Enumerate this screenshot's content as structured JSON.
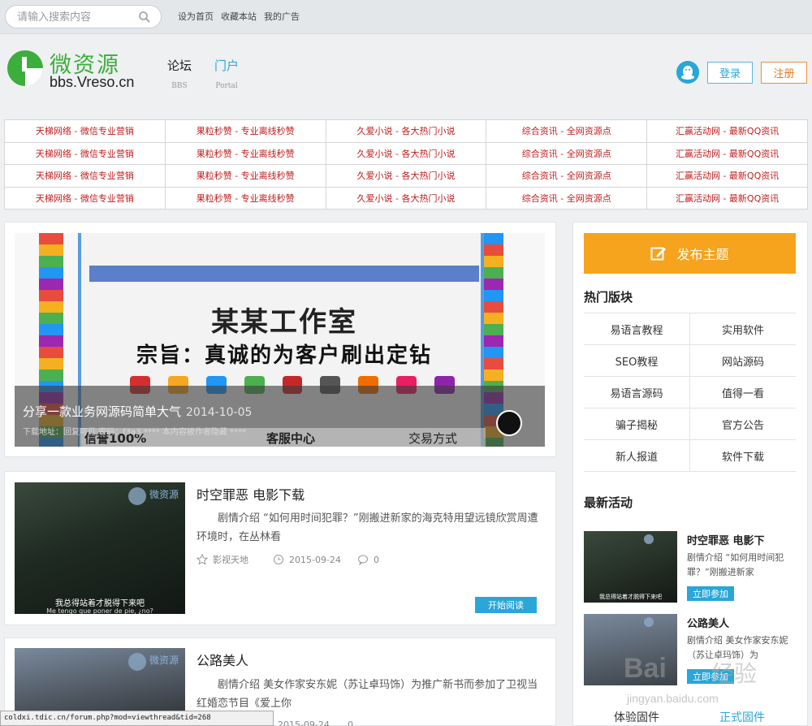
{
  "topbar": {
    "search_placeholder": "请输入搜索内容",
    "links": [
      "设为首页",
      "收藏本站",
      "我的广告"
    ]
  },
  "logo": {
    "cn": "微资源",
    "en": "bbs.Vreso.cn"
  },
  "nav": [
    {
      "label": "论坛",
      "sub": "BBS",
      "active": false
    },
    {
      "label": "门户",
      "sub": "Portal",
      "active": true
    }
  ],
  "auth": {
    "login": "登录",
    "register": "注册"
  },
  "ads": {
    "cells": [
      "天梯网络 - 微信专业营销",
      "果粒秒赞 - 专业离线秒赞",
      "久爱小说 - 各大热门小说",
      "综合资讯 - 全网资源点",
      "汇赢活动网 - 最新QQ资讯"
    ],
    "rows": 4
  },
  "banner": {
    "title": "分享一款业务网源码简单大气",
    "date": "2014-10-05",
    "sub": "下载地址：回复可见 密码：f3a3 **** 本内容被作者隐藏 ****",
    "art_line1": "某某工作室",
    "art_line2": "宗旨：真诚的为客户刷出定钻",
    "art_bottom": [
      "信誉100%",
      "客服中心",
      "交易方式"
    ]
  },
  "articles": [
    {
      "title": "时空罪恶 电影下载",
      "desc": "剧情介绍 “如何用时间犯罪？”刚搬进新家的海克特用望远镜欣赏周遭环境时，在丛林看",
      "category": "影视天地",
      "date": "2015-09-24",
      "comments": "0",
      "read": "开始阅读",
      "thumb_wm": "微资源",
      "thumb_cap": "我总得站着才脱得下来吧",
      "thumb_cap2": "Me tengo que poner de pie, ¿no?"
    },
    {
      "title": "公路美人",
      "desc": "剧情介绍 美女作家安东妮（苏让卓玛饰）为推广新书而参加了卫视当红婚恋节目《爱上你",
      "date": "2015-09-24",
      "comments": "0",
      "thumb_wm": "微资源"
    }
  ],
  "sidebar": {
    "post_label": "发布主题",
    "hot_heading": "热门版块",
    "hot": [
      [
        "易语言教程",
        "实用软件"
      ],
      [
        "SEO教程",
        "网站源码"
      ],
      [
        "易语言源码",
        "值得一看"
      ],
      [
        "骗子揭秘",
        "官方公告"
      ],
      [
        "新人报道",
        "软件下载"
      ]
    ],
    "events_heading": "最新活动",
    "events": [
      {
        "title": "时空罪恶 电影下",
        "desc": "剧情介绍 “如何用时间犯罪？”刚搬进新家",
        "btn": "立即参加",
        "cap": "我总得站着才脱得下来吧"
      },
      {
        "title": "公路美人",
        "desc": "剧情介绍 美女作家安东妮（苏让卓玛饰）为",
        "btn": "立即参加"
      }
    ],
    "tabs": [
      "体验固件",
      "正式固件"
    ]
  },
  "status": "coldxi.tdic.cn/forum.php?mod=viewthread&tid=268",
  "watermark": {
    "main": "Bai",
    "cn": "经验",
    "url": "jingyan.baidu.com"
  },
  "colors": {
    "accent": "#2aa6d8",
    "orange": "#f6a31d",
    "green": "#3bae3c",
    "ad_red": "#c01d1d"
  }
}
